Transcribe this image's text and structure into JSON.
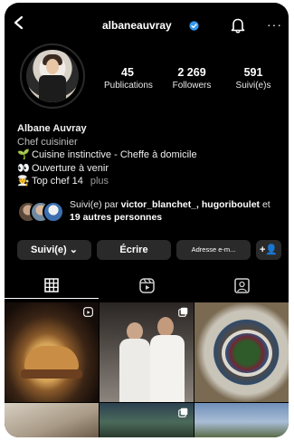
{
  "header": {
    "username": "albaneauvray",
    "icons": {
      "back": "chevron-left-icon",
      "verified": "verified-badge-icon",
      "notifications": "bell-icon",
      "more": "more-dots-icon"
    },
    "more_glyph": "···"
  },
  "profile": {
    "stats": [
      {
        "value": "45",
        "label": "Publications"
      },
      {
        "value": "2 269",
        "label": "Followers"
      },
      {
        "value": "591",
        "label": "Suivi(e)s"
      }
    ],
    "name": "Albane Auvray",
    "category": "Chef cuisinier",
    "bio_lines": [
      {
        "emoji": "🌱",
        "text": "Cuisine instinctive - Cheffe à domicile"
      },
      {
        "emoji": "👀",
        "text": "Ouverture à venir"
      },
      {
        "emoji": "🧑‍🍳",
        "text": "Top chef 14"
      }
    ],
    "more_label": "plus"
  },
  "mutuals": {
    "prefix": "Suivi(e) par ",
    "names": "victor_blanchet_, hugoriboulet",
    "suffix_connector": " et ",
    "others": "19 autres personnes"
  },
  "actions": {
    "following_label": "Suivi(e) ⌄",
    "message_label": "Écrire",
    "email_label": "Adresse e-m...",
    "add_user_label": "+👤"
  },
  "tabs": [
    {
      "name": "grid",
      "icon": "grid-icon",
      "active": true
    },
    {
      "name": "reels",
      "icon": "reels-icon",
      "active": false
    },
    {
      "name": "tagged",
      "icon": "tagged-icon",
      "active": false
    }
  ],
  "colors": {
    "background": "#000000",
    "button": "#2a2a2a",
    "verified": "#3797f0"
  }
}
